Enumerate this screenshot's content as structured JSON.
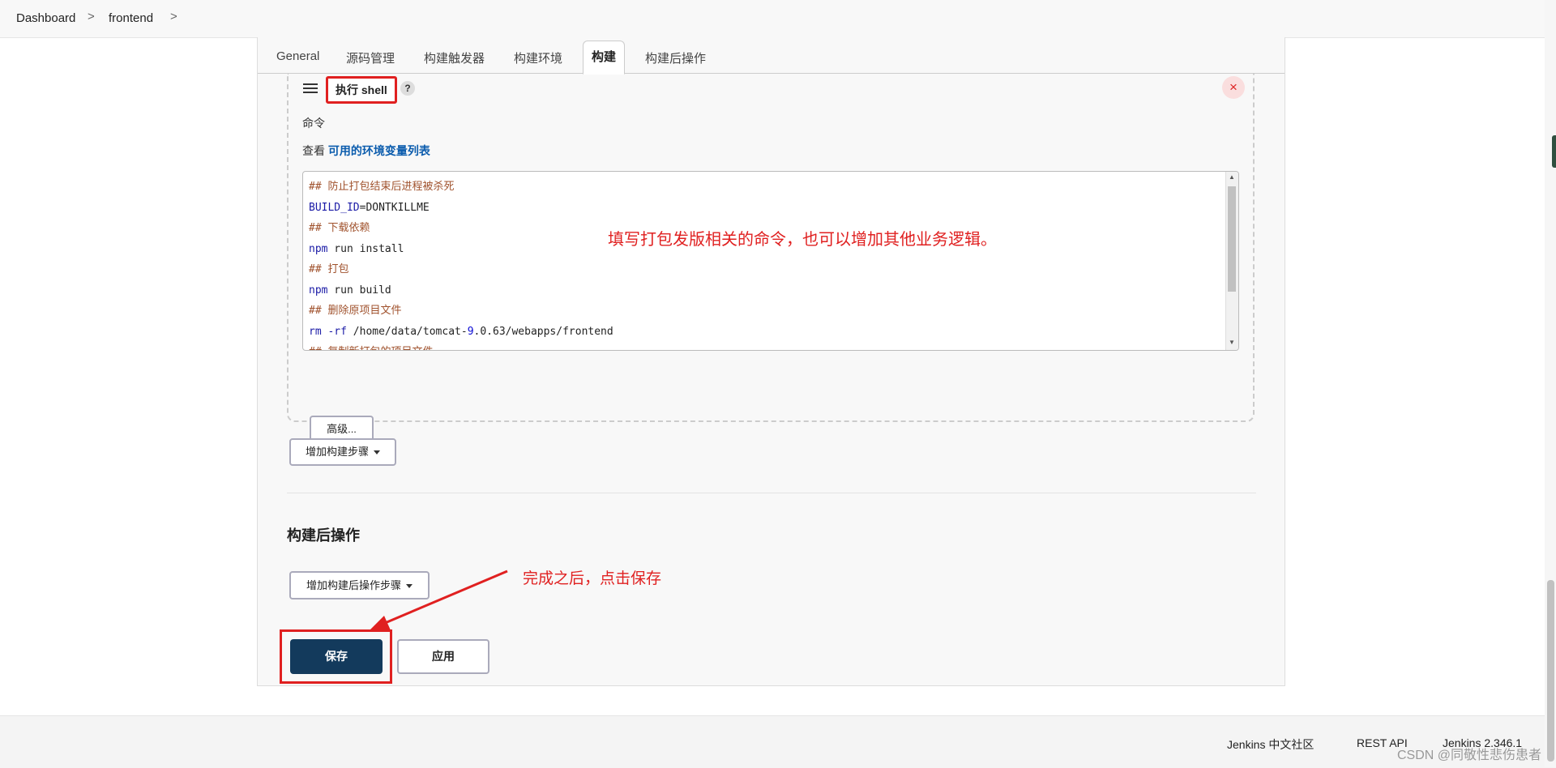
{
  "breadcrumb": {
    "items": [
      "Dashboard",
      "frontend"
    ],
    "separator": ">"
  },
  "tabs": [
    "General",
    "源码管理",
    "构建触发器",
    "构建环境",
    "构建",
    "构建后操作"
  ],
  "active_tab": "构建",
  "build_step": {
    "title": "执行 shell",
    "help": "?",
    "close": "×",
    "command_label": "命令",
    "env_prefix": "查看",
    "env_link": "可用的环境变量列表",
    "code_lines": [
      "## 防止打包结束后进程被杀死",
      "BUILD_ID=DONTKILLME",
      "## 下载依赖",
      "npm run install",
      "## 打包",
      "npm run build",
      "## 删除原项目文件",
      "rm -rf /home/data/tomcat-9.0.63/webapps/frontend",
      "## 复制新打包的项目文件"
    ],
    "advanced_button": "高级..."
  },
  "add_build_step_button": "增加构建步骤",
  "post_build": {
    "title": "构建后操作",
    "add_button": "增加构建后操作步骤"
  },
  "annotations": {
    "command_hint": "填写打包发版相关的命令，也可以增加其他业务逻辑。",
    "save_hint": "完成之后，点击保存"
  },
  "actions": {
    "save": "保存",
    "apply": "应用"
  },
  "footer": {
    "community": "Jenkins 中文社区",
    "rest_api": "REST API",
    "version": "Jenkins 2.346.1"
  },
  "watermark": "CSDN @同敬性悲伤患者",
  "colors": {
    "annotation_red": "#e02020",
    "save_button": "#133a5c",
    "link_blue": "#0b5cad"
  }
}
